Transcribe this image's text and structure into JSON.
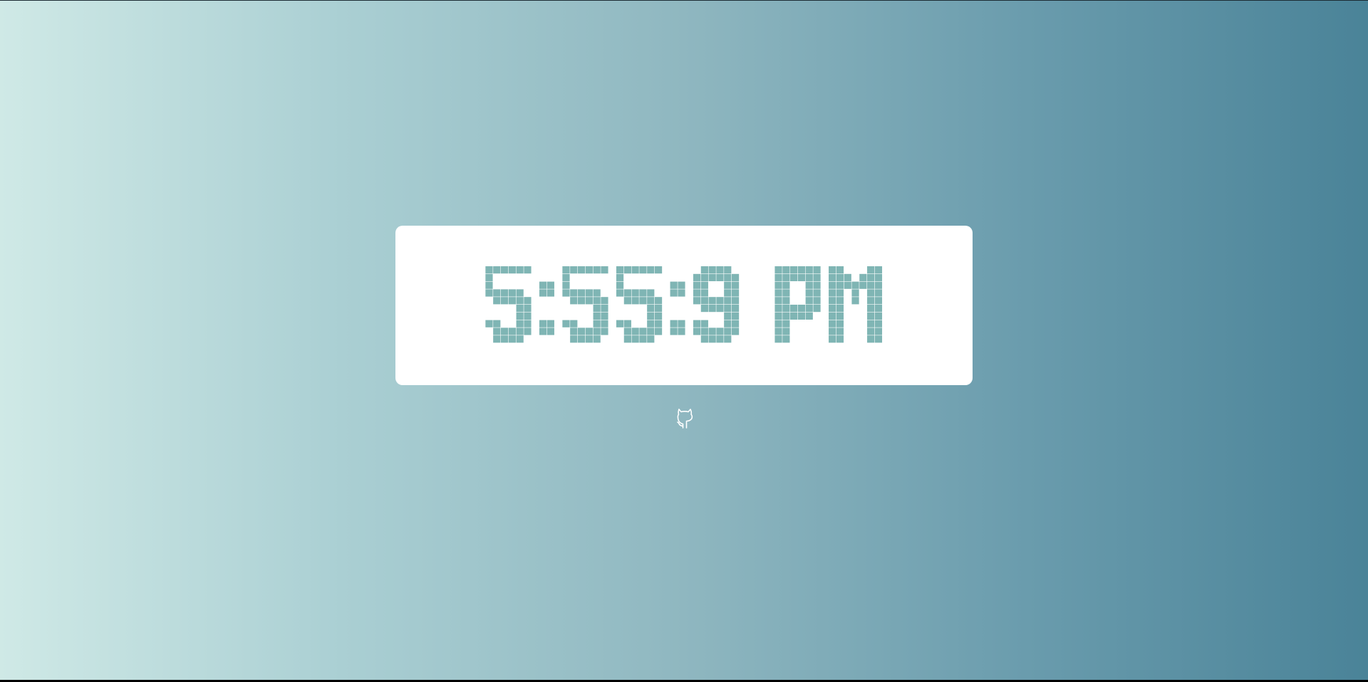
{
  "clock": {
    "time_text": "5:55:9 PM",
    "pixel_color": "#7fb5b4"
  },
  "footer": {
    "link_icon": "github-icon",
    "link_label": "GitHub"
  },
  "colors": {
    "gradient_start": "#cfe9e6",
    "gradient_end": "#4a8398",
    "card": "#ffffff"
  }
}
